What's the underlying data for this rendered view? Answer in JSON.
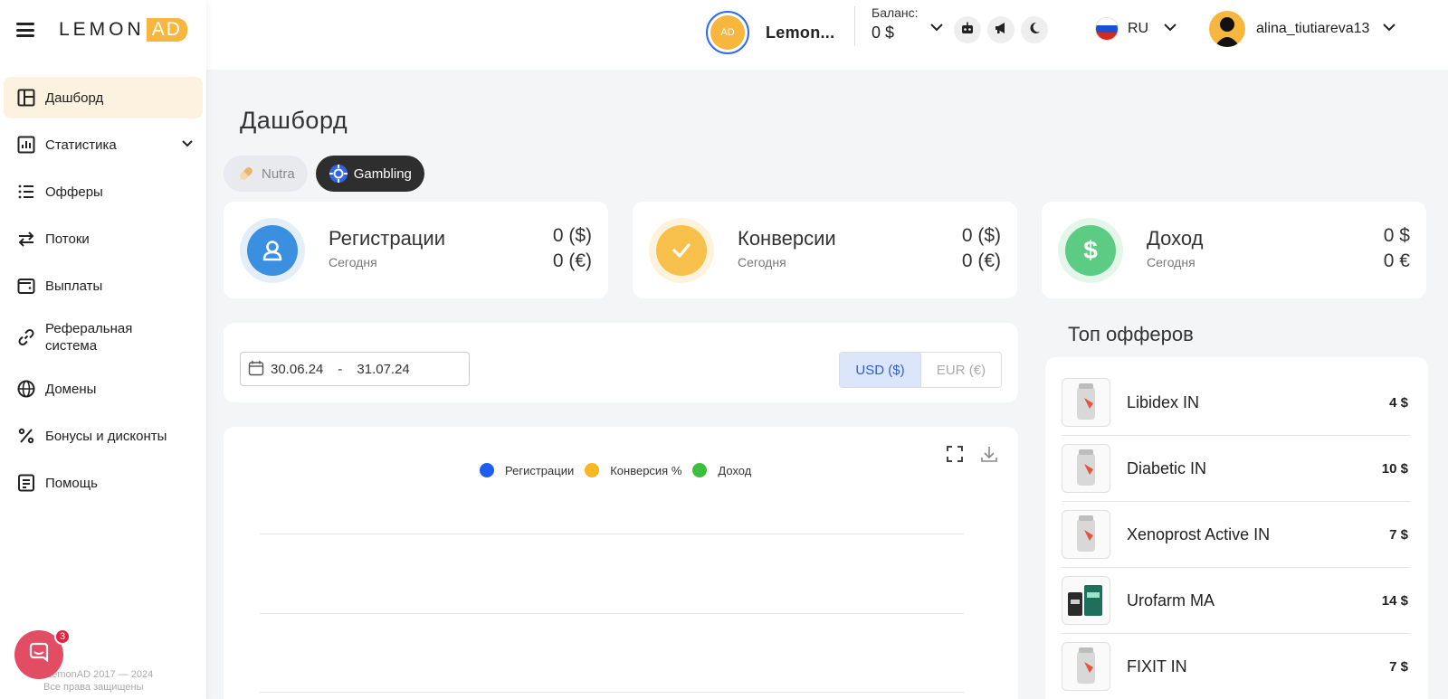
{
  "brand": {
    "logo_text": "LEMON",
    "logo_accent": "AD",
    "accent_color": "#f7b63d"
  },
  "sidebar": {
    "items": [
      {
        "label": "Дашборд",
        "icon": "dashboard-icon",
        "active": true
      },
      {
        "label": "Статистика",
        "icon": "chart-icon",
        "has_submenu": true
      },
      {
        "label": "Офферы",
        "icon": "list-icon"
      },
      {
        "label": "Потоки",
        "icon": "arrows-icon"
      },
      {
        "label": "Выплаты",
        "icon": "wallet-icon"
      },
      {
        "label": "Реферальная система",
        "icon": "link-icon"
      },
      {
        "label": "Домены",
        "icon": "globe-icon"
      },
      {
        "label": "Бонусы и дисконты",
        "icon": "percent-icon"
      },
      {
        "label": "Помощь",
        "icon": "help-icon"
      }
    ],
    "footer_line1": "© LemonAD 2017 — 2024",
    "footer_line2": "Все права защищены",
    "chat_badge": "3"
  },
  "header": {
    "account_avatar_text": "AD",
    "account_name": "Lemon...",
    "balance_label": "Баланс:",
    "balance_value": "0 $",
    "language": "RU",
    "username": "alina_tiutiareva13"
  },
  "main": {
    "title": "Дашборд",
    "tabs": [
      {
        "label": "Nutra",
        "active": false
      },
      {
        "label": "Gambling",
        "active": true
      }
    ],
    "stats": [
      {
        "title": "Регистрации",
        "subtitle": "Сегодня",
        "value1": "0 ($)",
        "value2": "0 (€)",
        "color": "#3a8fe0"
      },
      {
        "title": "Конверсии",
        "subtitle": "Сегодня",
        "value1": "0 ($)",
        "value2": "0 (€)",
        "color": "#f7c04a"
      },
      {
        "title": "Доход",
        "subtitle": "Сегодня",
        "value1": "0 $",
        "value2": "0 €",
        "color": "#5ccb83"
      }
    ],
    "date_from": "30.06.24",
    "date_sep": "-",
    "date_to": "31.07.24",
    "currency_usd": "USD ($)",
    "currency_eur": "EUR (€)",
    "legend": [
      {
        "label": "Регистрации",
        "color": "#1f5cf0"
      },
      {
        "label": "Конверсия %",
        "color": "#f7b824"
      },
      {
        "label": "Доход",
        "color": "#3cbf3f"
      }
    ]
  },
  "top_offers": {
    "title": "Топ офферов",
    "items": [
      {
        "name": "Libidex IN",
        "value": "4 $"
      },
      {
        "name": "Diabetic IN",
        "value": "10 $"
      },
      {
        "name": "Xenoprost Active IN",
        "value": "7 $"
      },
      {
        "name": "Urofarm MA",
        "value": "14 $"
      },
      {
        "name": "FIXIT IN",
        "value": "7 $"
      }
    ]
  }
}
